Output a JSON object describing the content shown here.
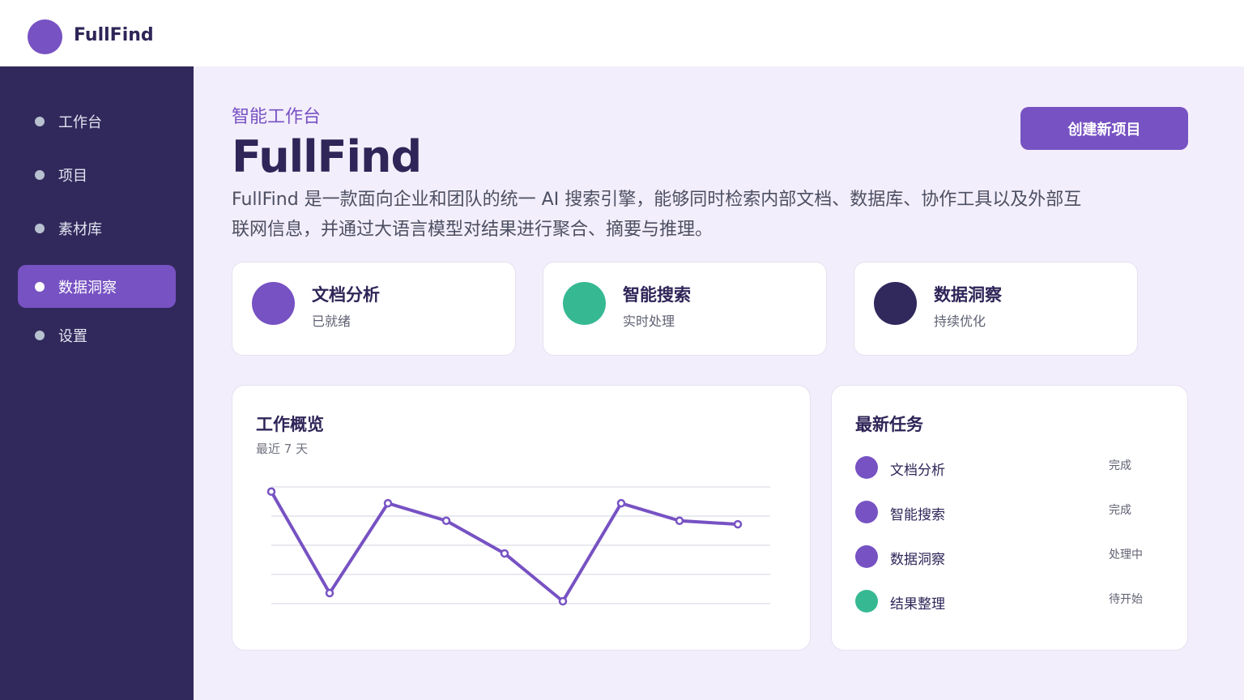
{
  "app": {
    "brand": "FullFind"
  },
  "sidebar": {
    "items": [
      {
        "label": "工作台",
        "active": false
      },
      {
        "label": "项目",
        "active": false
      },
      {
        "label": "素材库",
        "active": false
      },
      {
        "label": "数据洞察",
        "active": true
      },
      {
        "label": "设置",
        "active": false
      }
    ]
  },
  "header": {
    "eyebrow": "智能工作台",
    "title": "FullFind",
    "description": "FullFind 是一款面向企业和团队的统一 AI 搜索引擎，能够同时检索内部文档、数据库、协作工具以及外部互联网信息，并通过大语言模型对结果进行聚合、摘要与推理。",
    "create_button": "创建新项目"
  },
  "stats": [
    {
      "title": "文档分析",
      "sub": "已就绪",
      "color": "#7752c3"
    },
    {
      "title": "智能搜索",
      "sub": "实时处理",
      "color": "#36b992"
    },
    {
      "title": "数据洞察",
      "sub": "持续优化",
      "color": "#31295c"
    }
  ],
  "overview": {
    "title": "工作概览",
    "subtitle": "最近 7 天"
  },
  "chart_data": {
    "type": "line",
    "x": [
      1,
      2,
      3,
      4,
      5,
      6,
      7,
      8,
      9
    ],
    "series": [
      {
        "values": [
          96,
          9,
          86,
          71,
          43,
          2,
          86,
          71,
          68
        ],
        "color": "#7752c3"
      }
    ],
    "ylim": [
      0,
      100
    ],
    "grid": true,
    "title": "",
    "xlabel": "",
    "ylabel": ""
  },
  "tasks": {
    "title": "最新任务",
    "items": [
      {
        "name": "文档分析",
        "status": "完成",
        "color": "#7752c3"
      },
      {
        "name": "智能搜索",
        "status": "完成",
        "color": "#7752c3"
      },
      {
        "name": "数据洞察",
        "status": "处理中",
        "color": "#7752c3"
      },
      {
        "name": "结果整理",
        "status": "待开始",
        "color": "#36b992"
      }
    ]
  }
}
